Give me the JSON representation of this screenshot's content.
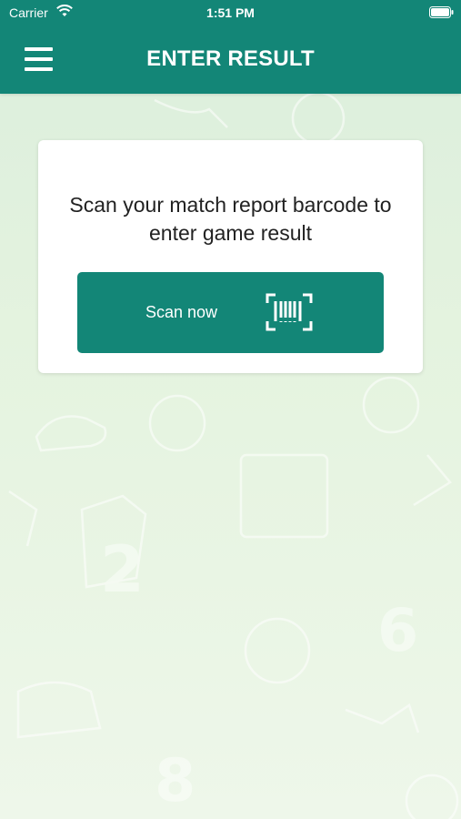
{
  "status_bar": {
    "carrier": "Carrier",
    "time": "1:51 PM",
    "wifi_icon": "wifi-icon",
    "battery_icon": "battery-icon"
  },
  "header": {
    "title": "ENTER RESULT",
    "menu_icon": "hamburger-menu-icon",
    "background_color": "#138677"
  },
  "card": {
    "instruction": "Scan your match report barcode to enter game result",
    "scan_button_label": "Scan now",
    "scan_icon": "barcode-scan-icon",
    "accent_color": "#138677"
  }
}
